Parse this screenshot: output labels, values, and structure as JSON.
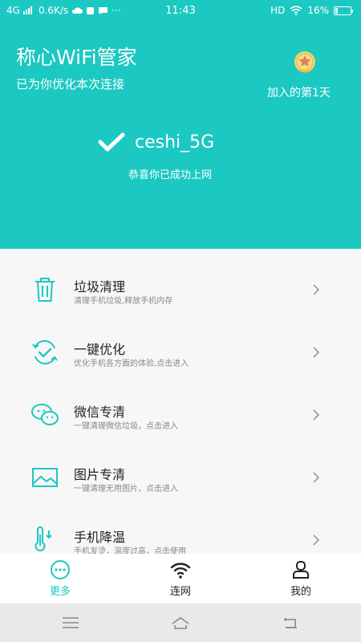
{
  "status_bar": {
    "network": "4G",
    "speed": "0.6K/s",
    "time": "11:43",
    "hd": "HD",
    "battery": "16%",
    "battery_level": 0.16
  },
  "header": {
    "title": "称心WiFi管家",
    "subtitle": "已为你优化本次连接",
    "join_days": "加入的第1天",
    "network_name": "ceshi_5G",
    "congrats": "恭喜你已成功上网"
  },
  "features": [
    {
      "title": "垃圾清理",
      "desc": "清理手机垃圾,释放手机内存",
      "icon": "trash-icon"
    },
    {
      "title": "一键优化",
      "desc": "优化手机各方面的体验,点击进入",
      "icon": "optimize-icon"
    },
    {
      "title": "微信专清",
      "desc": "一键清理微信垃圾，点击进入",
      "icon": "wechat-icon"
    },
    {
      "title": "图片专清",
      "desc": "一键清理无用图片，点击进入",
      "icon": "image-icon"
    },
    {
      "title": "手机降温",
      "desc": "手机发烫，温度过高，点击使用",
      "icon": "thermometer-icon"
    }
  ],
  "tabs": [
    {
      "label": "更多",
      "icon": "more-icon",
      "active": true
    },
    {
      "label": "连网",
      "icon": "wifi-icon",
      "active": false
    },
    {
      "label": "我的",
      "icon": "profile-icon",
      "active": false
    }
  ],
  "colors": {
    "accent": "#1CC8C2",
    "list_bg": "#F7F7F7"
  }
}
